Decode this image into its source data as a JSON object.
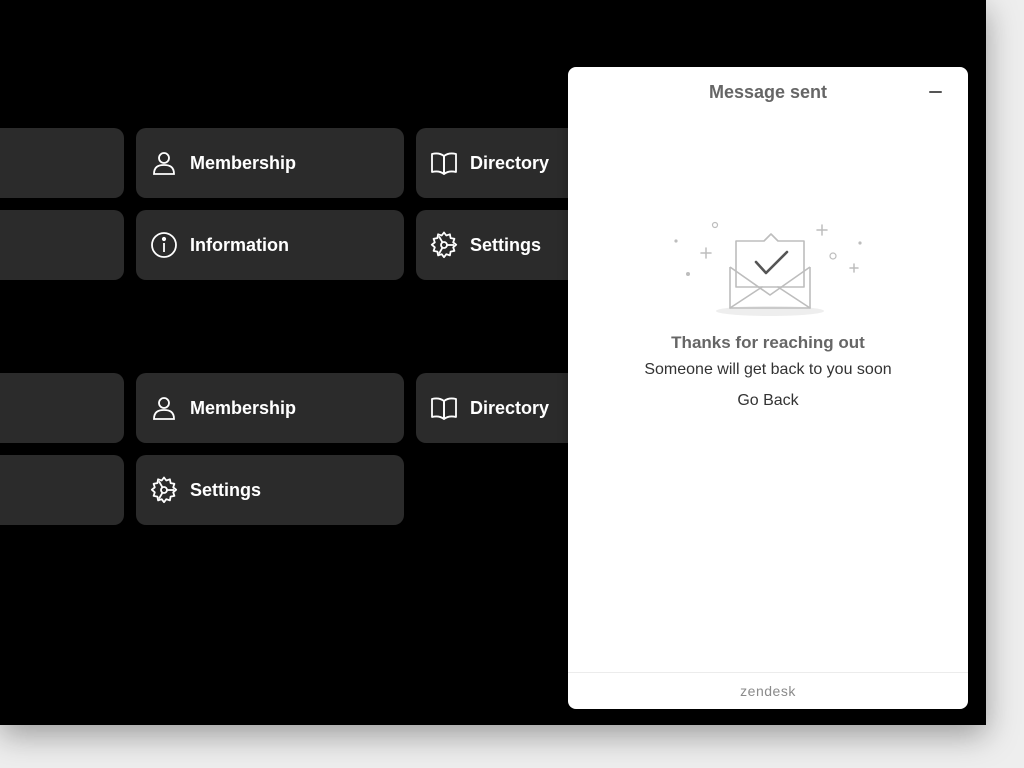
{
  "tiles": [
    {
      "label": "Membership",
      "icon": "person-icon"
    },
    {
      "label": "Directory",
      "icon": "book-icon"
    },
    {
      "label": "Information",
      "icon": "info-icon"
    },
    {
      "label": "Settings",
      "icon": "gear-icon"
    },
    {
      "label": "Membership",
      "icon": "person-icon"
    },
    {
      "label": "Directory",
      "icon": "book-icon"
    },
    {
      "label": "Settings",
      "icon": "gear-icon"
    }
  ],
  "widget": {
    "title": "Message sent",
    "minimize_icon": "minus-icon",
    "illustration_icon": "envelope-check-icon",
    "heading": "Thanks for reaching out",
    "message": "Someone will get back to you soon",
    "go_back_label": "Go Back",
    "footer_brand": "zendesk"
  },
  "colors": {
    "screen_background": "#000000",
    "tile_background": "#2b2b2b",
    "tile_text": "#ffffff",
    "widget_background": "#ffffff",
    "widget_title": "#666666",
    "footer_brand": "#8a8a8a"
  }
}
